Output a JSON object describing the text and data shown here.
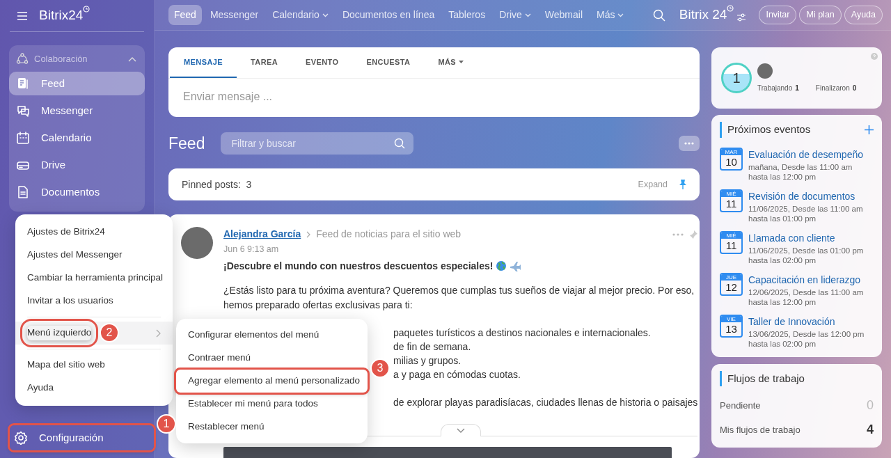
{
  "sidebar": {
    "logo": "Bitrix24",
    "group": {
      "title": "Colaboración",
      "expanded": true,
      "items": [
        {
          "label": "Feed",
          "kind": "feed",
          "selected": true
        },
        {
          "label": "Messenger",
          "kind": "chat",
          "selected": false
        },
        {
          "label": "Calendario",
          "kind": "calendar",
          "selected": false
        },
        {
          "label": "Drive",
          "kind": "drive",
          "selected": false
        },
        {
          "label": "Documentos",
          "kind": "document",
          "selected": false
        }
      ]
    },
    "settings": {
      "label": "Configuración",
      "callout": "1"
    }
  },
  "top_nav": {
    "tabs": [
      {
        "label": "Feed",
        "selected": true,
        "dropdown": false
      },
      {
        "label": "Messenger",
        "selected": false,
        "dropdown": false
      },
      {
        "label": "Calendario",
        "selected": false,
        "dropdown": true
      },
      {
        "label": "Documentos en línea",
        "selected": false,
        "dropdown": false
      },
      {
        "label": "Tableros",
        "selected": false,
        "dropdown": false
      },
      {
        "label": "Drive",
        "selected": false,
        "dropdown": true
      },
      {
        "label": "Webmail",
        "selected": false,
        "dropdown": false
      },
      {
        "label": "Más",
        "selected": false,
        "dropdown": true
      }
    ],
    "logo": "Bitrix 24",
    "buttons": [
      "Invitar",
      "Mi plan",
      "Ayuda"
    ]
  },
  "composer": {
    "tabs": [
      {
        "label": "MENSAJE",
        "selected": true,
        "dropdown": false
      },
      {
        "label": "TAREA",
        "selected": false,
        "dropdown": false
      },
      {
        "label": "EVENTO",
        "selected": false,
        "dropdown": false
      },
      {
        "label": "ENCUESTA",
        "selected": false,
        "dropdown": false
      },
      {
        "label": "MÁS",
        "selected": false,
        "dropdown": true
      }
    ],
    "placeholder": "Enviar mensaje ..."
  },
  "feed": {
    "title": "Feed",
    "filter": {
      "placeholder": "Filtrar y buscar"
    },
    "pinned": {
      "label": "Pinned posts:  3",
      "action": "Expand"
    },
    "post": {
      "author": "Alejandra García",
      "destination": "Feed de noticias para el sitio web",
      "date": "Jun 6 9:13 am",
      "title": "¡Descubre el mundo con nuestros descuentos especiales!",
      "paragraph": "¿Estás listo para tu próxima aventura? Queremos que cumplas tus sueños de viajar al mejor precio. Por eso, hemos preparado ofertas exclusivas para ti:",
      "partial_lines": [
        "paquetes turísticos a destinos nacionales e internacionales.",
        "de fin de semana.",
        "milias y grupos.",
        "a y paga en cómodas cuotas.",
        "de explorar playas paradisíacas, ciudades llenas de historia o paisajes"
      ]
    }
  },
  "timeman": {
    "value": "1",
    "stats": [
      {
        "label": "Trabajando",
        "count": "1"
      },
      {
        "label": "Finalizaron",
        "count": "0"
      }
    ]
  },
  "events": {
    "title": "Próximos eventos",
    "items": [
      {
        "month": "MAR",
        "day": "10",
        "title": "Evaluación de desempeño",
        "detail": "mañana, Desde las 11:00 am hasta las 12:00 pm"
      },
      {
        "month": "MIÉ",
        "day": "11",
        "title": "Revisión de documentos",
        "detail": "11/06/2025, Desde las 11:00 am hasta las 01:00 pm"
      },
      {
        "month": "MIÉ",
        "day": "11",
        "title": "Llamada con cliente",
        "detail": "11/06/2025, Desde las 01:00 pm hasta las 02:00 pm"
      },
      {
        "month": "JUE",
        "day": "12",
        "title": "Capacitación en liderazgo",
        "detail": "12/06/2025, Desde las 11:00 am hasta las 12:00 pm"
      },
      {
        "month": "VIE",
        "day": "13",
        "title": "Taller de Innovación",
        "detail": "13/06/2025, Desde las 12:00 pm hasta las 02:00 pm"
      }
    ]
  },
  "workflows": {
    "title": "Flujos de trabajo",
    "items": [
      {
        "label": "Pendiente",
        "count": "0",
        "active": false
      },
      {
        "label": "Mis flujos de trabajo",
        "count": "4",
        "active": true
      }
    ]
  },
  "settings_menu": {
    "items": [
      {
        "label": "Ajustes de Bitrix24",
        "selected": false,
        "submenu": false
      },
      {
        "label": "Ajustes del Messenger",
        "selected": false,
        "submenu": false
      },
      {
        "label": "Cambiar la herramienta principal",
        "selected": false,
        "submenu": false
      },
      {
        "label": "Invitar a los usuarios",
        "selected": false,
        "submenu": false,
        "divider_after": true
      },
      {
        "label": "Menú izquierdo",
        "selected": true,
        "submenu": true,
        "divider_after": true,
        "callout": "2"
      },
      {
        "label": "Mapa del sitio web",
        "selected": false,
        "submenu": false
      },
      {
        "label": "Ayuda",
        "selected": false,
        "submenu": false
      }
    ]
  },
  "submenu": {
    "items": [
      {
        "label": "Configurar elementos del menú",
        "selected": false
      },
      {
        "label": "Contraer menú",
        "selected": false
      },
      {
        "label": "Agregar elemento al menú personalizado",
        "selected": false,
        "callout": "3"
      },
      {
        "label": "Establecer mi menú para todos",
        "selected": false
      },
      {
        "label": "Restablecer menú",
        "selected": false
      }
    ]
  }
}
